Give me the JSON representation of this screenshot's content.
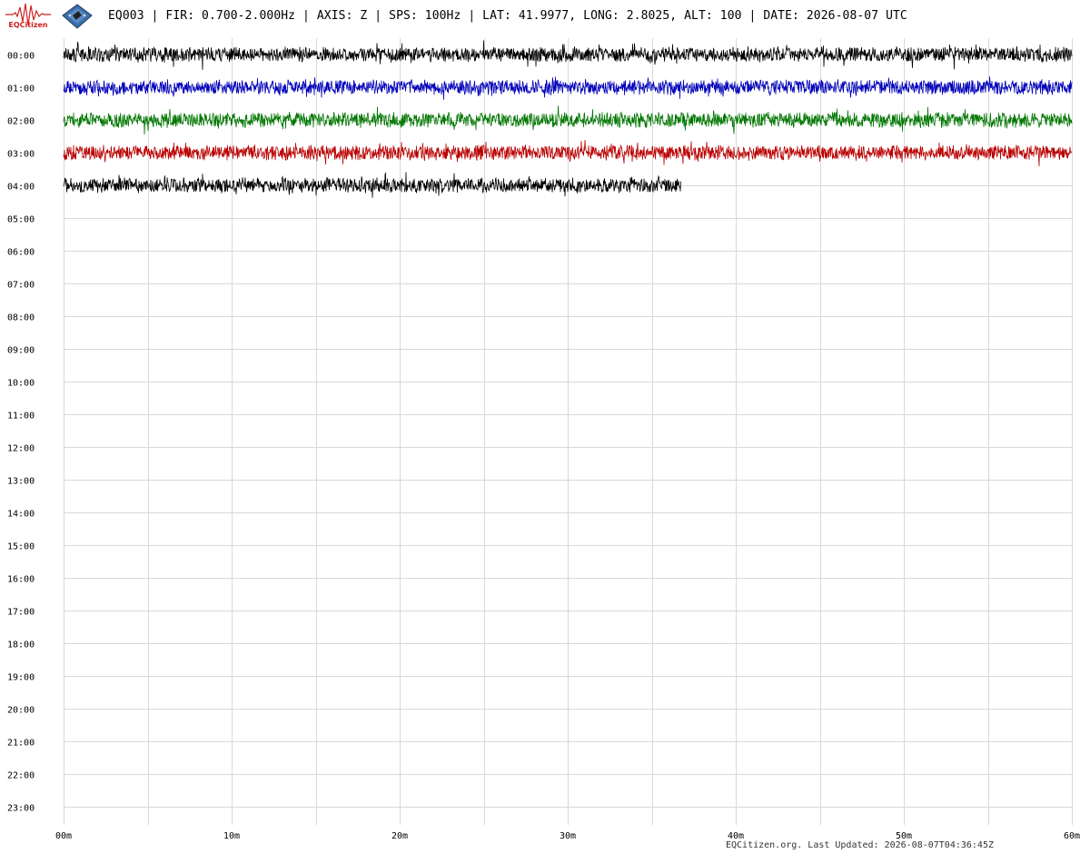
{
  "header": {
    "title": "EQ003 | FIR: 0.700-2.000Hz | AXIS: Z | SPS: 100Hz | LAT: 41.9977, LONG: 2.8025, ALT: 100 | DATE: 2026-08-07 UTC",
    "logo_text": "EQCitizen",
    "logo_icon": "seismograph-logo-icon",
    "device_icon": "sensor-board-icon"
  },
  "footer": {
    "text": "EQCitizen.org. Last Updated: 2026-08-07T04:36:45Z"
  },
  "chart_data": {
    "type": "line",
    "title": "",
    "xlabel": "",
    "ylabel": "",
    "x_tick_labels": [
      "00m",
      "10m",
      "20m",
      "30m",
      "40m",
      "50m",
      "60m"
    ],
    "xlim": [
      0,
      60
    ],
    "x_grid_step_minutes": 5,
    "y_tick_labels": [
      "00:00",
      "01:00",
      "02:00",
      "03:00",
      "04:00",
      "05:00",
      "06:00",
      "07:00",
      "08:00",
      "09:00",
      "10:00",
      "11:00",
      "12:00",
      "13:00",
      "14:00",
      "15:00",
      "16:00",
      "17:00",
      "18:00",
      "19:00",
      "20:00",
      "21:00",
      "22:00",
      "23:00"
    ],
    "grid": true,
    "series": [
      {
        "hour": "00:00",
        "start_minute": 0,
        "end_minute": 60,
        "color": "#000000"
      },
      {
        "hour": "01:00",
        "start_minute": 0,
        "end_minute": 60,
        "color": "#0000bb"
      },
      {
        "hour": "02:00",
        "start_minute": 0,
        "end_minute": 60,
        "color": "#007700"
      },
      {
        "hour": "03:00",
        "start_minute": 0,
        "end_minute": 60,
        "color": "#bb0000"
      },
      {
        "hour": "04:00",
        "start_minute": 0,
        "end_minute": 36.75,
        "color": "#000000"
      }
    ]
  }
}
